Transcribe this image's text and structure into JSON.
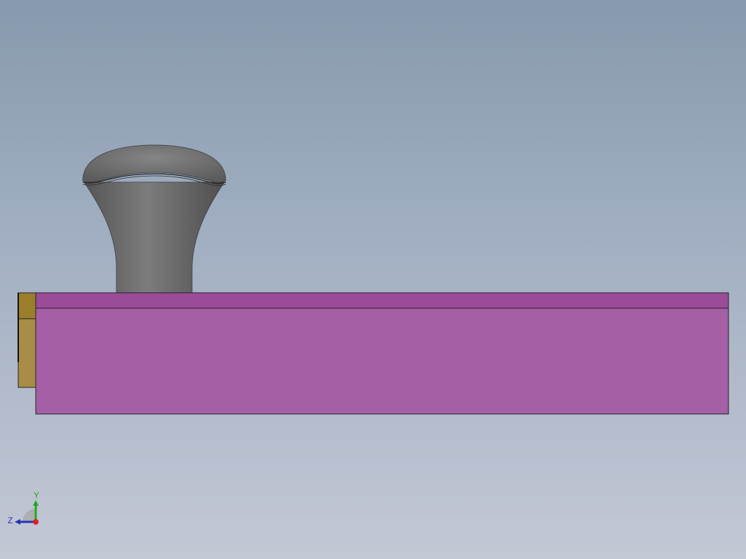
{
  "viewport": {
    "background_top": "#8799ae",
    "background_bottom": "#c3c8d5"
  },
  "model": {
    "handle_color": "#6e6e6e",
    "plate_color": "#a45fa6",
    "plate_top_strip_color": "#9a4c98",
    "end_block_top_color": "#9a7e2c",
    "end_block_color": "#a98c48"
  },
  "triad": {
    "y_label": "Y",
    "z_label": "Z",
    "y_color": "#22a722",
    "z_color": "#2233bb",
    "x_color": "#dd2222",
    "icons": [
      "view-orientation-triad-icon"
    ]
  }
}
